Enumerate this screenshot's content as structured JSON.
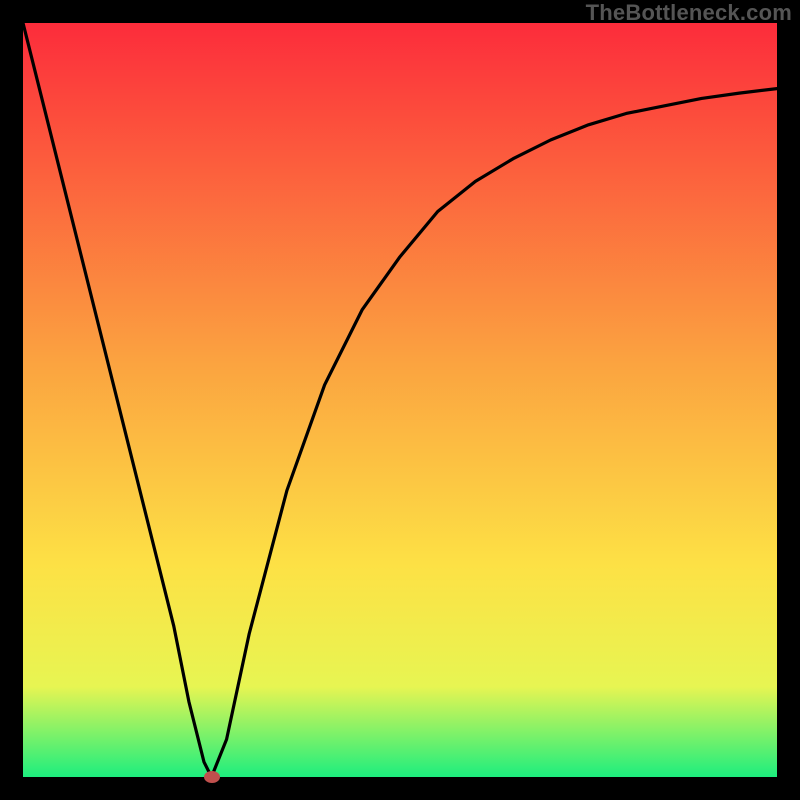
{
  "watermark": "TheBottleneck.com",
  "chart_data": {
    "type": "line",
    "title": "",
    "xlabel": "",
    "ylabel": "",
    "xlim": [
      0,
      100
    ],
    "ylim": [
      0,
      100
    ],
    "grid": false,
    "background_gradient": {
      "top_color": "#fc2c3b",
      "mid_color": "#ffd244",
      "bottom_color": "#1dee7e"
    },
    "series": [
      {
        "name": "curve",
        "x": [
          0,
          5,
          10,
          15,
          18,
          20,
          22,
          24,
          25,
          27,
          30,
          35,
          40,
          45,
          50,
          55,
          60,
          65,
          70,
          75,
          80,
          85,
          90,
          95,
          100
        ],
        "y": [
          100,
          80,
          60,
          40,
          28,
          20,
          10,
          2,
          0,
          5,
          19,
          38,
          52,
          62,
          69,
          75,
          79,
          82,
          84.5,
          86.5,
          88,
          89,
          90,
          90.7,
          91.3
        ]
      }
    ],
    "marker": {
      "x": 25,
      "y": 0,
      "color": "#c0504d",
      "shape": "ellipse"
    }
  }
}
